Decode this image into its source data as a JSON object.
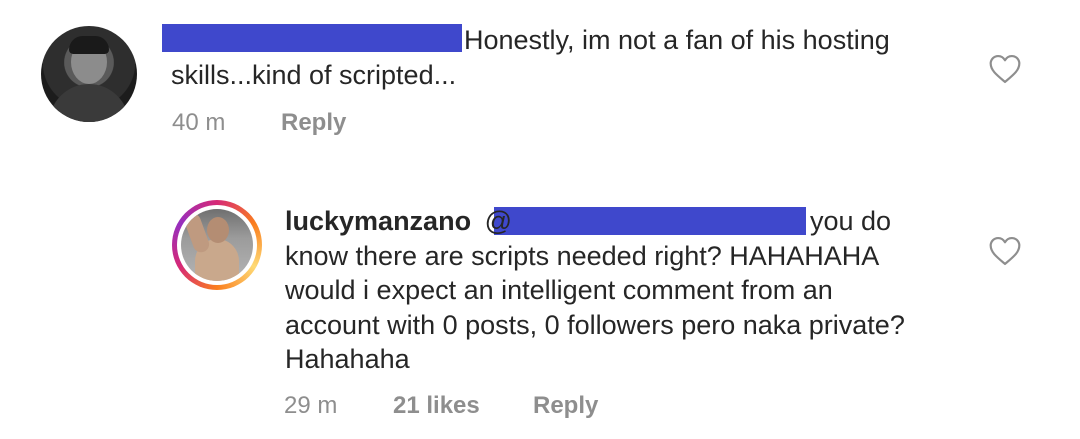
{
  "comment1": {
    "text_line1": "Honestly, im not a fan of his hosting",
    "text_line2": "skills...kind of scripted...",
    "time": "40 m",
    "reply_label": "Reply"
  },
  "comment2": {
    "username": "luckymanzano",
    "mention_prefix": "@",
    "text_line1": "you do",
    "text_line2": "know there are scripts needed right? HAHAHAHA",
    "text_line3": "would i expect an intelligent comment from an",
    "text_line4": "account with 0 posts, 0 followers pero naka private?",
    "text_line5": "Hahahaha",
    "time": "29 m",
    "likes": "21 likes",
    "reply_label": "Reply"
  },
  "icons": {
    "like": "heart-outline-icon"
  },
  "colors": {
    "redaction": "#3f48cc",
    "meta": "#8e8e8e",
    "text": "#262626"
  }
}
